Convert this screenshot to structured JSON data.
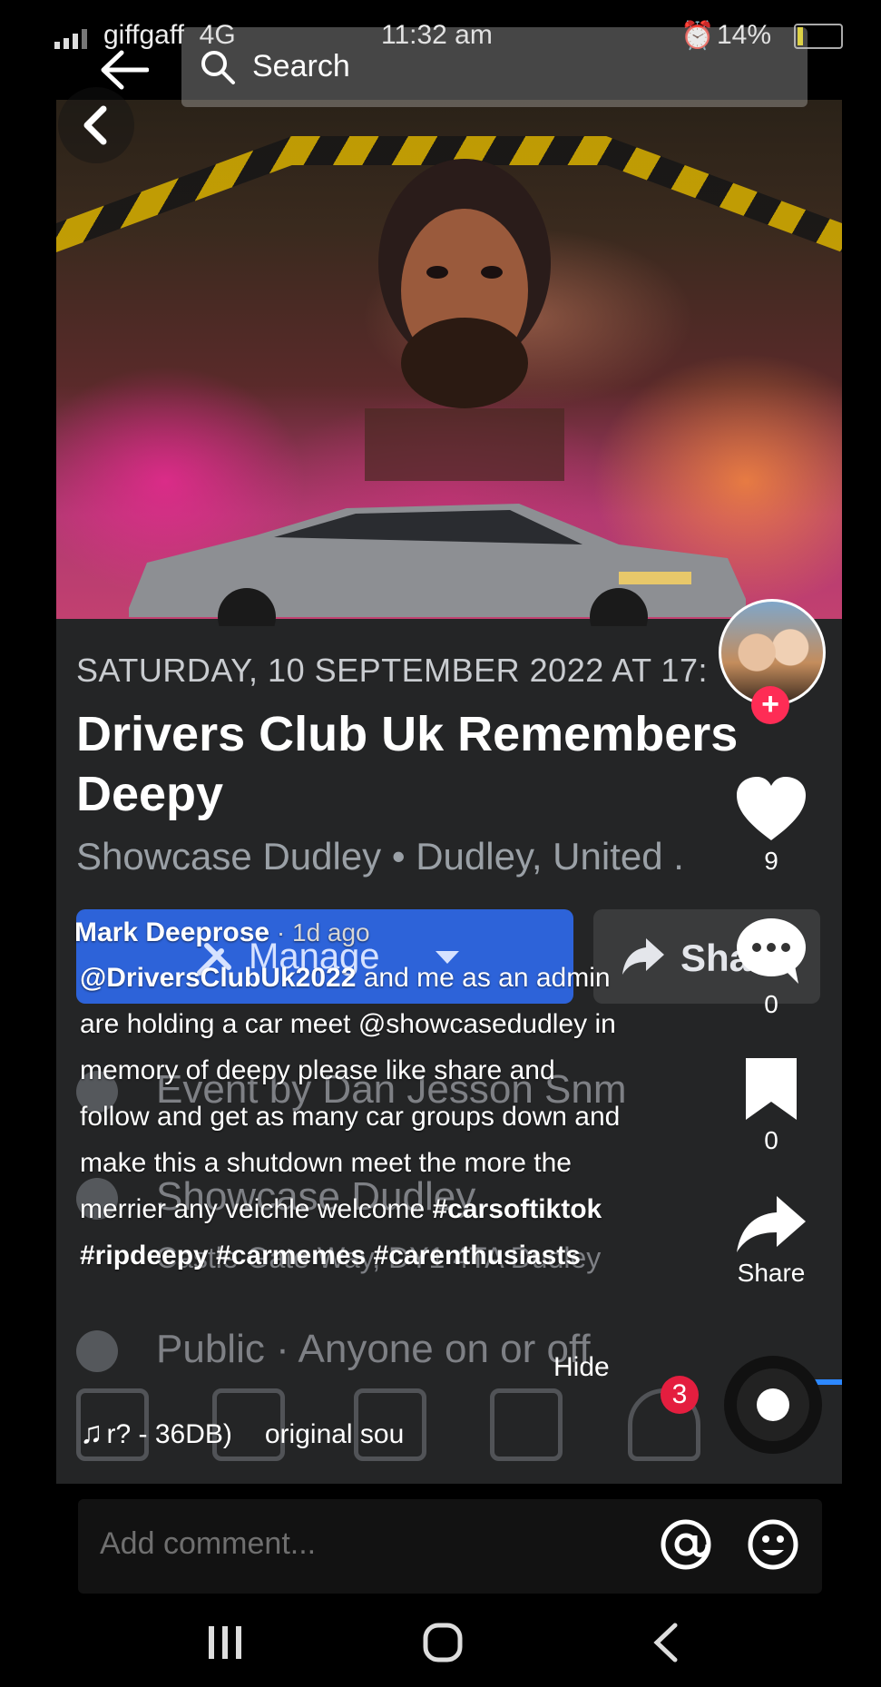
{
  "status_bar": {
    "carrier": "giffgaff",
    "network": "4G",
    "time": "11:32 am",
    "battery": "14%"
  },
  "search": {
    "placeholder": "Search"
  },
  "event": {
    "date": "SATURDAY, 10 SEPTEMBER 2022 AT 17:",
    "title": "Drivers Club Uk Remembers Deepy",
    "location": "Showcase Dudley • Dudley, United ."
  },
  "fb_buttons": {
    "manage": "Manage",
    "share": "Share"
  },
  "fb_faded": {
    "organiser": "Event by Dan Jesson Snm",
    "venue": "Showcase Dudley",
    "address": "Castle Gate Way, DY1 4TA Dudley",
    "privacy": "Public · Anyone on or off"
  },
  "fb_nav": {
    "notification_badge": "3"
  },
  "caption": {
    "author": "Mark Deeprose",
    "ago": " · 1d ago",
    "mention1": "@DriversClubUk2022",
    "text1": " and me as an admin are holding a car meet ",
    "mention2": "@showcasedudley",
    "text2": " in memory of deepy please like share and follow and get as many car groups down and make this a shutdown meet the more the merrier any veichle welcome ",
    "hashtags": "#carsoftiktok #ripdeepy #carmemes #carenthusiasts"
  },
  "hide_label": "Hide",
  "music": {
    "partial": "r? - 36DB)",
    "song": "original sou"
  },
  "actions": {
    "likes": "9",
    "comments": "0",
    "bookmarks": "0",
    "share_label": "Share"
  },
  "comment": {
    "placeholder": "Add comment..."
  },
  "colors": {
    "tiktok_red": "#fe2c55",
    "fb_blue": "#2d63d9",
    "panel_bg": "#242526"
  }
}
